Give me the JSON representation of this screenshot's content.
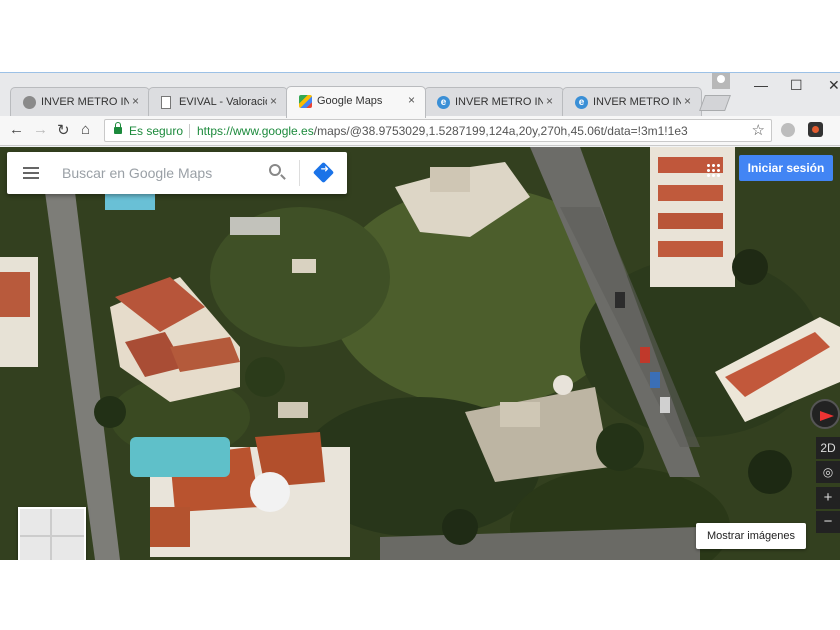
{
  "tabs": [
    {
      "title": "INVER METRO INMOBILIARIA",
      "favicon": "globe-icon",
      "active": false
    },
    {
      "title": "EVIVAL - Valoraciones",
      "favicon": "document-icon",
      "active": false
    },
    {
      "title": "Google Maps",
      "favicon": "google-maps-icon",
      "active": true
    },
    {
      "title": "INVER METRO INMOBILIARIA",
      "favicon": "ie-icon",
      "active": false
    },
    {
      "title": "INVER METRO INMOBILIARIA",
      "favicon": "ie-icon",
      "active": false
    }
  ],
  "tab_close": "×",
  "window": {
    "minimize": "—",
    "maximize": "☐",
    "close": "✕"
  },
  "toolbar": {
    "back": "←",
    "forward": "→",
    "reload": "↻",
    "home": "⌂",
    "star": "☆"
  },
  "omnibox": {
    "security_label": "Es seguro",
    "url_origin": "https://www.google.es",
    "url_path": "/maps/@38.9753029,1.5287199,124a,20y,270h,45.06t/data=!3m1!1e3"
  },
  "maps": {
    "search_placeholder": "Buscar en Google Maps",
    "sign_in": "Iniciar sesión",
    "show_images": "Mostrar imágenes",
    "view_2d": "2D",
    "zoom_in": "+",
    "zoom_out": "−",
    "locate": "◎"
  },
  "colors": {
    "brand_blue": "#4285f4",
    "secure_green": "#1c8a3c"
  }
}
